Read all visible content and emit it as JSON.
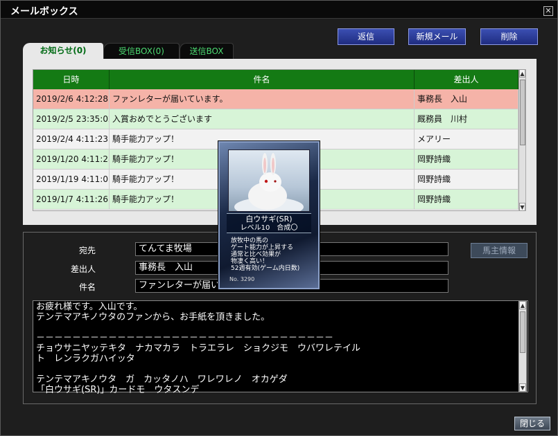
{
  "window": {
    "title": "メールボックス",
    "close_glyph": "✕"
  },
  "toolbar": {
    "reply_label": "返信",
    "new_label": "新規メール",
    "delete_label": "削除"
  },
  "tabs": [
    {
      "label": "お知らせ(0)",
      "active": true
    },
    {
      "label": "受信BOX(0)",
      "active": false
    },
    {
      "label": "送信BOX",
      "active": false
    }
  ],
  "table": {
    "columns": [
      "日時",
      "件名",
      "差出人"
    ],
    "rows": [
      {
        "date": "2019/2/6 4:12:28",
        "subject": "ファンレターが届いています。",
        "sender": "事務長　入山",
        "state": "selected"
      },
      {
        "date": "2019/2/5 23:35:02",
        "subject": "入賞おめでとうございます",
        "sender": "厩務員　川村",
        "state": "green"
      },
      {
        "date": "2019/2/4 4:11:23",
        "subject": "騎手能力アップ！",
        "sender": "メアリー",
        "state": "white"
      },
      {
        "date": "2019/1/20 4:11:28",
        "subject": "騎手能力アップ！",
        "sender": "岡野詩織",
        "state": "green"
      },
      {
        "date": "2019/1/19 4:11:01",
        "subject": "騎手能力アップ！",
        "sender": "岡野詩織",
        "state": "white"
      },
      {
        "date": "2019/1/7 4:11:26",
        "subject": "騎手能力アップ！",
        "sender": "岡野詩織",
        "state": "green"
      }
    ]
  },
  "detail": {
    "to_label": "宛先",
    "to_value": "てんてま牧場",
    "from_label": "差出人",
    "from_value": "事務長　入山",
    "subject_label": "件名",
    "subject_value": "ファンレターが届い",
    "owner_info_label": "馬主情報",
    "body": "お疲れ様です。入山です。\nテンテマアキノウタのファンから、お手紙を頂きました。\n\n－－－－－－－－－－－－－－－－－－－－－－－－－－－－－－－－－\nチョウサニヤッテキタ　ナカマカラ　トラエラレ　ショクジモ　ウバワレテイル\nト　レンラクガハイッタ\n\nテンテマアキノウタ　ガ　カッタノハ　ワレワレノ　オカゲダ\n「白ウサギ(SR)」カードモ　ウタスンデ"
  },
  "card": {
    "name": "白ウサギ(SR)",
    "level": "レベル10　合成〇",
    "description": "放牧中の馬の\nゲート能力が上昇する\n通常と比べ効果が\n物凄く高い！\n52週有効(ゲーム内日数)",
    "number": "No. 3290",
    "subject": "white-rabbit-image"
  },
  "footer": {
    "close_label": "閉じる"
  }
}
